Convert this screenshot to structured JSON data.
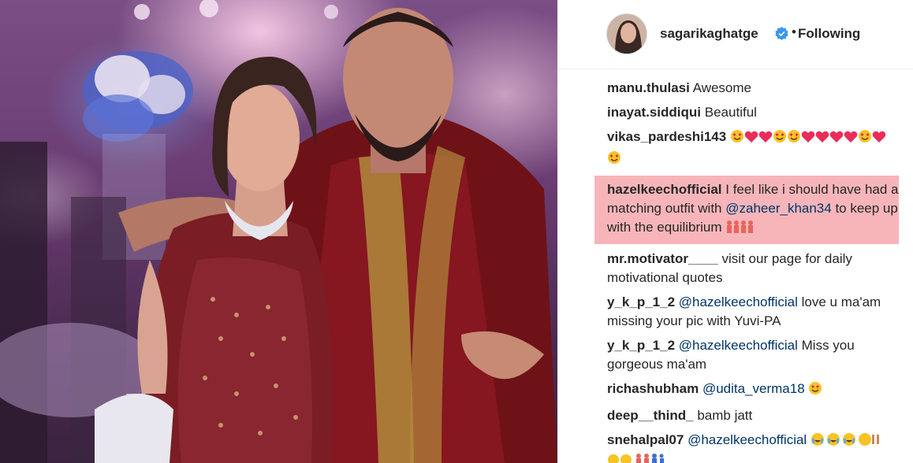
{
  "header": {
    "username": "sagarikaghatge",
    "separator": "•",
    "follow_status": "Following"
  },
  "comments": [
    {
      "user": "manu.thulasi",
      "text": "Awesome",
      "emojis": []
    },
    {
      "user": "inayat.siddiqui",
      "text": "Beautiful",
      "emojis": []
    },
    {
      "user": "vikas_pardeshi143",
      "text": "",
      "emojis": [
        "heart-eyes",
        "heart",
        "heart",
        "heart-eyes",
        "heart-eyes",
        "heart",
        "heart",
        "heart",
        "heart",
        "heart-eyes",
        "heart",
        "heart-eyes"
      ]
    },
    {
      "user": "hazelkeechofficial",
      "text_before": "I feel like i should have had a matching outfit with ",
      "mention": "@zaheer_khan34",
      "text_after": " to keep up with the equilibrium",
      "highlighted": true
    },
    {
      "user": "mr.motivator____",
      "text": "visit our page for daily motivational quotes"
    },
    {
      "user": "y_k_p_1_2",
      "mention": "@hazelkeechofficial",
      "text": "love u ma'am missing your pic with Yuvi-PA"
    },
    {
      "user": "y_k_p_1_2",
      "mention": "@hazelkeechofficial",
      "text": "Miss you gorgeous ma'am"
    },
    {
      "user": "richashubham",
      "mention": "@udita_verma18",
      "text": ""
    },
    {
      "user": "deep__thind_",
      "text": "bamb jatt"
    },
    {
      "user": "snehalpal07",
      "mention": "@hazelkeechofficial",
      "text": ""
    }
  ],
  "colors": {
    "highlight": "#f07882",
    "verified_badge": "#3897f0",
    "mention": "#003569"
  }
}
